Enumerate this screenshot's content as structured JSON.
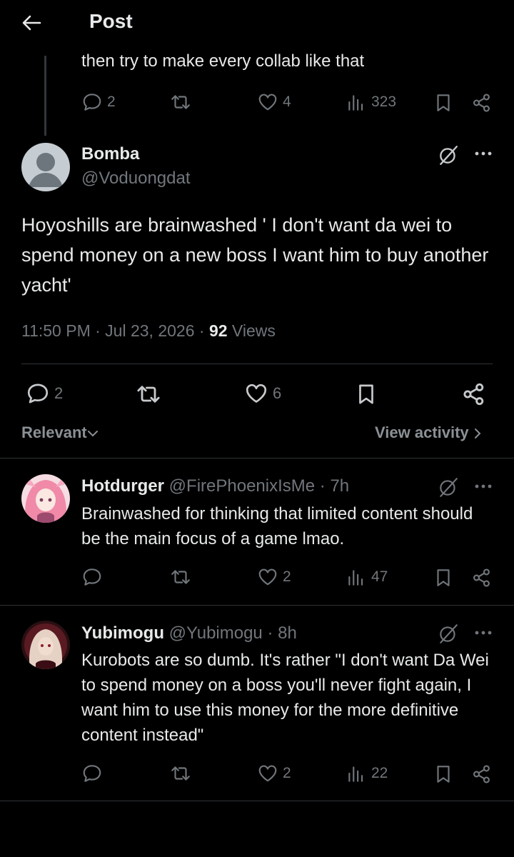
{
  "header": {
    "title": "Post"
  },
  "parent_tweet": {
    "text": "then try to make every collab like that",
    "replies": "2",
    "likes": "4",
    "views": "323"
  },
  "main_tweet": {
    "display_name": "Bomba",
    "handle": "@Voduongdat",
    "text": "Hoyoshills are brainwashed ' I don't want da wei to spend money on a new boss I want him to buy another yacht'",
    "time": "11:50 PM · Jul 23, 2026 · ",
    "views_count": "92",
    "views_label": " Views",
    "replies": "2",
    "likes": "6"
  },
  "sort": {
    "label": "Relevant",
    "view_activity": "View activity"
  },
  "replies": [
    {
      "display_name": "Hotdurger",
      "handle": "@FirePhoenixIsMe",
      "age": "· 7h",
      "text": "Brainwashed for thinking that limited content should be the main focus of a game lmao.",
      "likes": "2",
      "views": "47"
    },
    {
      "display_name": "Yubimogu",
      "handle": "@Yubimogu",
      "age": "· 8h",
      "text": "Kurobots are so dumb. It's rather \"I don't want Da Wei to spend money on a boss you'll never fight again, I want him to use this money for the more definitive content instead\"",
      "likes": "2",
      "views": "22"
    }
  ],
  "icons": {
    "back": "arrow-left-icon",
    "reply": "reply-icon",
    "repost": "repost-icon",
    "like": "heart-icon",
    "views": "views-icon",
    "bookmark": "bookmark-icon",
    "share": "share-icon",
    "grok": "grok-icon",
    "more": "more-icon"
  },
  "colors": {
    "background": "#000000",
    "text": "#e7e9ea",
    "muted": "#71767b",
    "divider": "#2f3336"
  }
}
